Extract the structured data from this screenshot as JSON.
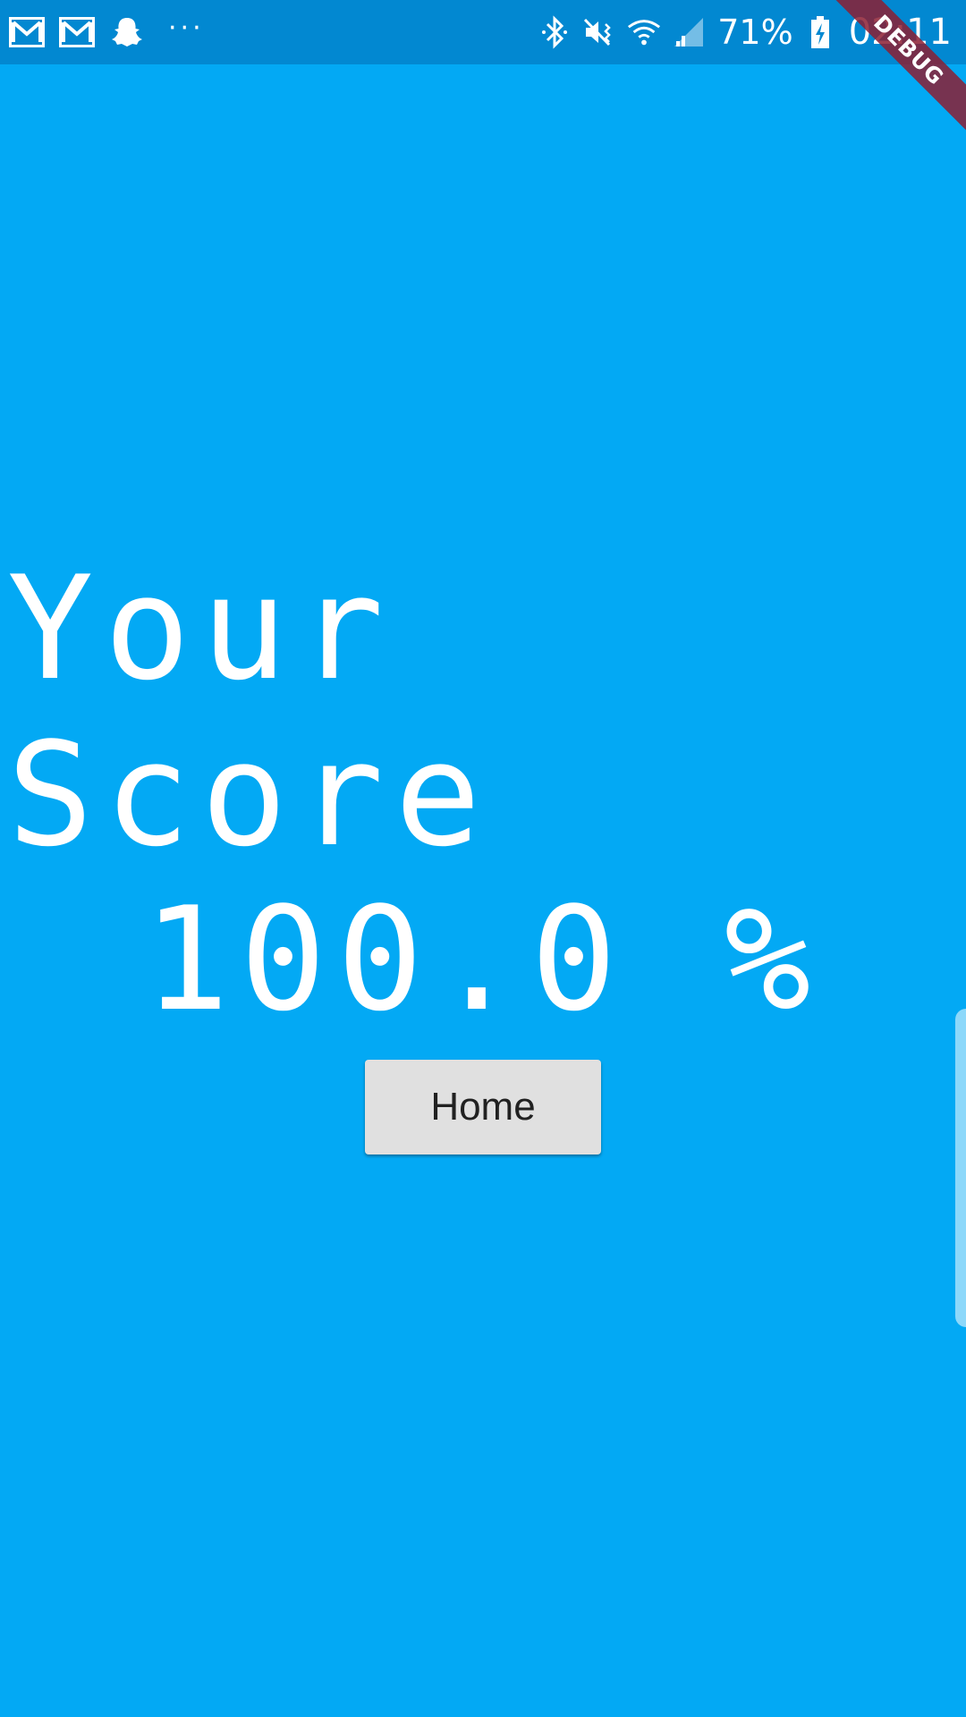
{
  "status_bar": {
    "left_icons": [
      "gmail-icon",
      "gmail-icon",
      "snapchat-icon"
    ],
    "more_indicator": "···",
    "right_icons": [
      "bluetooth-icon",
      "mute-vibrate-icon",
      "wifi-icon",
      "signal-icon"
    ],
    "battery_percent": "71%",
    "battery_icon": "battery-charging-icon",
    "time": "02:11"
  },
  "debug_banner": {
    "label": "DEBUG"
  },
  "main": {
    "title": "Your Score",
    "score": "100.0 %",
    "home_button_label": "Home"
  },
  "colors": {
    "background": "#03A9F4",
    "status_bar": "#0288D1",
    "button": "#E0E0E0",
    "debug_banner": "#8C1E32"
  }
}
